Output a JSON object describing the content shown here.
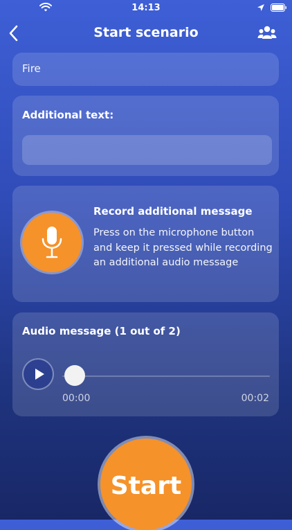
{
  "status": {
    "time": "14:13"
  },
  "header": {
    "title": "Start scenario"
  },
  "scenario": {
    "value": "Fire"
  },
  "additional_text": {
    "label": "Additional text:",
    "value": ""
  },
  "record": {
    "title": "Record additional message",
    "description": "Press on the microphone button and keep it pressed while recording an additional audio message"
  },
  "audio": {
    "title": "Audio message (1 out of 2)",
    "current_time": "00:00",
    "total_time": "00:02",
    "progress": 0.0
  },
  "start": {
    "label": "Start"
  },
  "colors": {
    "accent": "#f5922a"
  }
}
